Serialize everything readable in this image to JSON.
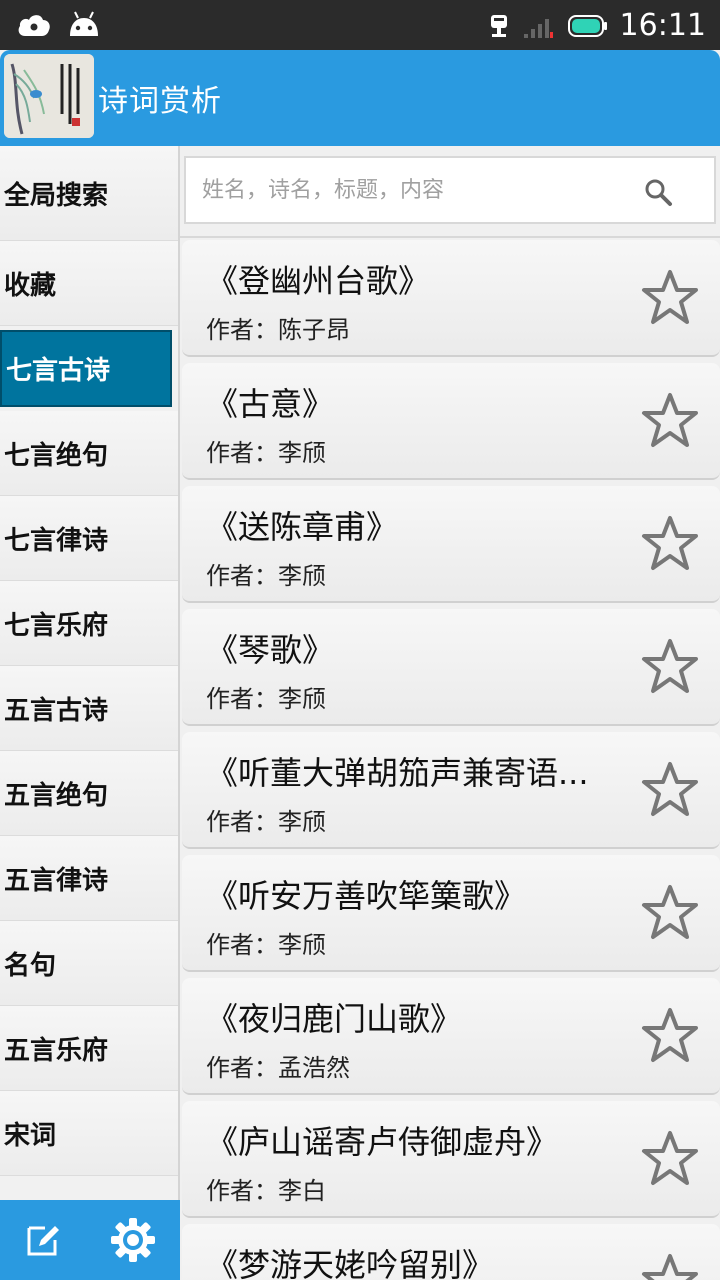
{
  "status_bar": {
    "time": "16:11"
  },
  "app": {
    "title": "诗词赏析"
  },
  "search": {
    "placeholder": "姓名，诗名，标题，内容"
  },
  "sidebar": {
    "items": [
      {
        "label": "全局搜索",
        "active": false
      },
      {
        "label": "收藏",
        "active": false
      },
      {
        "label": "七言古诗",
        "active": true
      },
      {
        "label": "七言绝句",
        "active": false
      },
      {
        "label": "七言律诗",
        "active": false
      },
      {
        "label": "七言乐府",
        "active": false
      },
      {
        "label": "五言古诗",
        "active": false
      },
      {
        "label": "五言绝句",
        "active": false
      },
      {
        "label": "五言律诗",
        "active": false
      },
      {
        "label": "名句",
        "active": false
      },
      {
        "label": "五言乐府",
        "active": false
      },
      {
        "label": "宋词",
        "active": false
      }
    ]
  },
  "poems": [
    {
      "title": "《登幽州台歌》",
      "author": "作者：陈子昂"
    },
    {
      "title": "《古意》",
      "author": "作者：李颀"
    },
    {
      "title": "《送陈章甫》",
      "author": "作者：李颀"
    },
    {
      "title": "《琴歌》",
      "author": "作者：李颀"
    },
    {
      "title": "《听董大弹胡笳声兼寄语...",
      "author": "作者：李颀"
    },
    {
      "title": "《听安万善吹筚篥歌》",
      "author": "作者：李颀"
    },
    {
      "title": "《夜归鹿门山歌》",
      "author": "作者：孟浩然"
    },
    {
      "title": "《庐山谣寄卢侍御虚舟》",
      "author": "作者：李白"
    },
    {
      "title": "《梦游天姥吟留别》",
      "author": ""
    }
  ],
  "colors": {
    "accent": "#2a9ae0",
    "active_item": "#00749e",
    "status_bar": "#2b2b2b"
  },
  "icons": {
    "sidebar_bottom_left": "edit-icon",
    "sidebar_bottom_right": "gear-icon",
    "search": "search-icon",
    "favorite": "star-outline-icon"
  }
}
